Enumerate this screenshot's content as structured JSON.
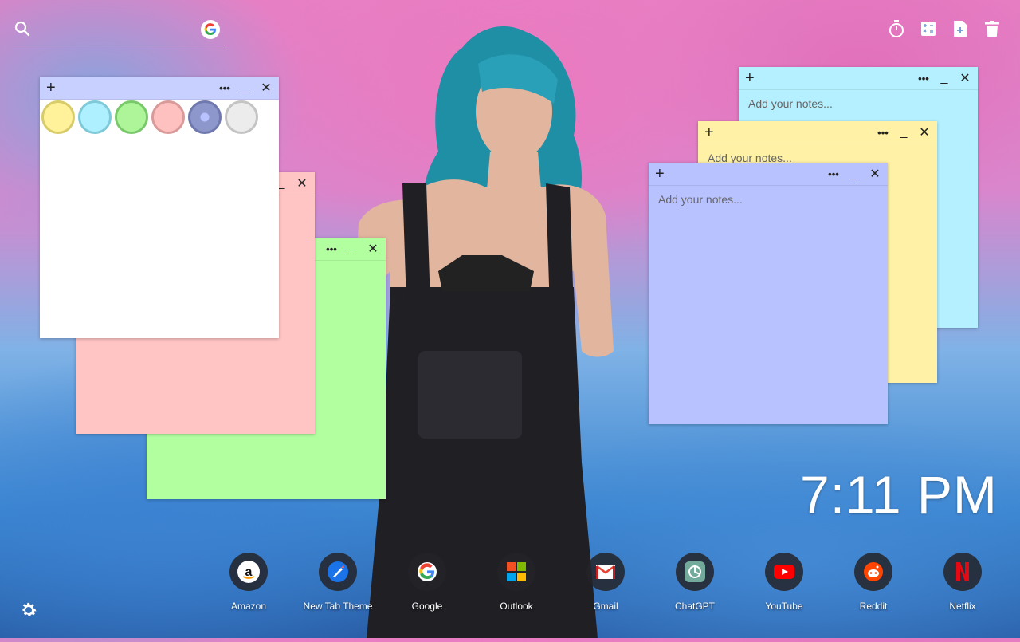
{
  "search": {
    "placeholder": "",
    "engine_icon": "google-icon"
  },
  "toolbar": {
    "buttons": [
      {
        "name": "timer-button",
        "icon": "stopwatch-icon"
      },
      {
        "name": "calculator-button",
        "icon": "calculator-icon"
      },
      {
        "name": "add-note-button",
        "icon": "add-note-icon"
      },
      {
        "name": "delete-all-button",
        "icon": "trash-icon"
      }
    ]
  },
  "notes": {
    "add_label": "+",
    "menu_label": "•••",
    "minimize_label": "_",
    "close_label": "✕",
    "placeholder": "Add your notes...",
    "colors": {
      "white": "#ffffff",
      "pink": "#ffc4c4",
      "green": "#b2ffa0",
      "cyan": "#b4f0ff",
      "yellow": "#fff2a6",
      "blue": "#b8c2ff",
      "header_white": "#c8d0ff"
    },
    "palette": [
      {
        "fill": "#fff29a",
        "ring": "#d8cc6a"
      },
      {
        "fill": "#aef0ff",
        "ring": "#7fc9d9"
      },
      {
        "fill": "#aef59a",
        "ring": "#79c96b"
      },
      {
        "fill": "#ffc0c0",
        "ring": "#d99a9a"
      },
      {
        "fill": "#8e97cc",
        "ring": "#7079ad"
      },
      {
        "fill": "#ececec",
        "ring": "#c4c4c4"
      }
    ]
  },
  "clock": {
    "time": "7:11 PM"
  },
  "dock": {
    "apps": [
      {
        "label": "Amazon",
        "icon": "amazon-icon"
      },
      {
        "label": "New Tab Theme",
        "icon": "new-tab-theme-icon"
      },
      {
        "label": "Google",
        "icon": "google-icon"
      },
      {
        "label": "Outlook",
        "icon": "microsoft-icon"
      },
      {
        "label": "Gmail",
        "icon": "gmail-icon"
      },
      {
        "label": "ChatGPT",
        "icon": "chatgpt-icon"
      },
      {
        "label": "YouTube",
        "icon": "youtube-icon"
      },
      {
        "label": "Reddit",
        "icon": "reddit-icon"
      },
      {
        "label": "Netflix",
        "icon": "netflix-icon"
      }
    ]
  },
  "settings": {
    "icon": "gear-icon"
  }
}
